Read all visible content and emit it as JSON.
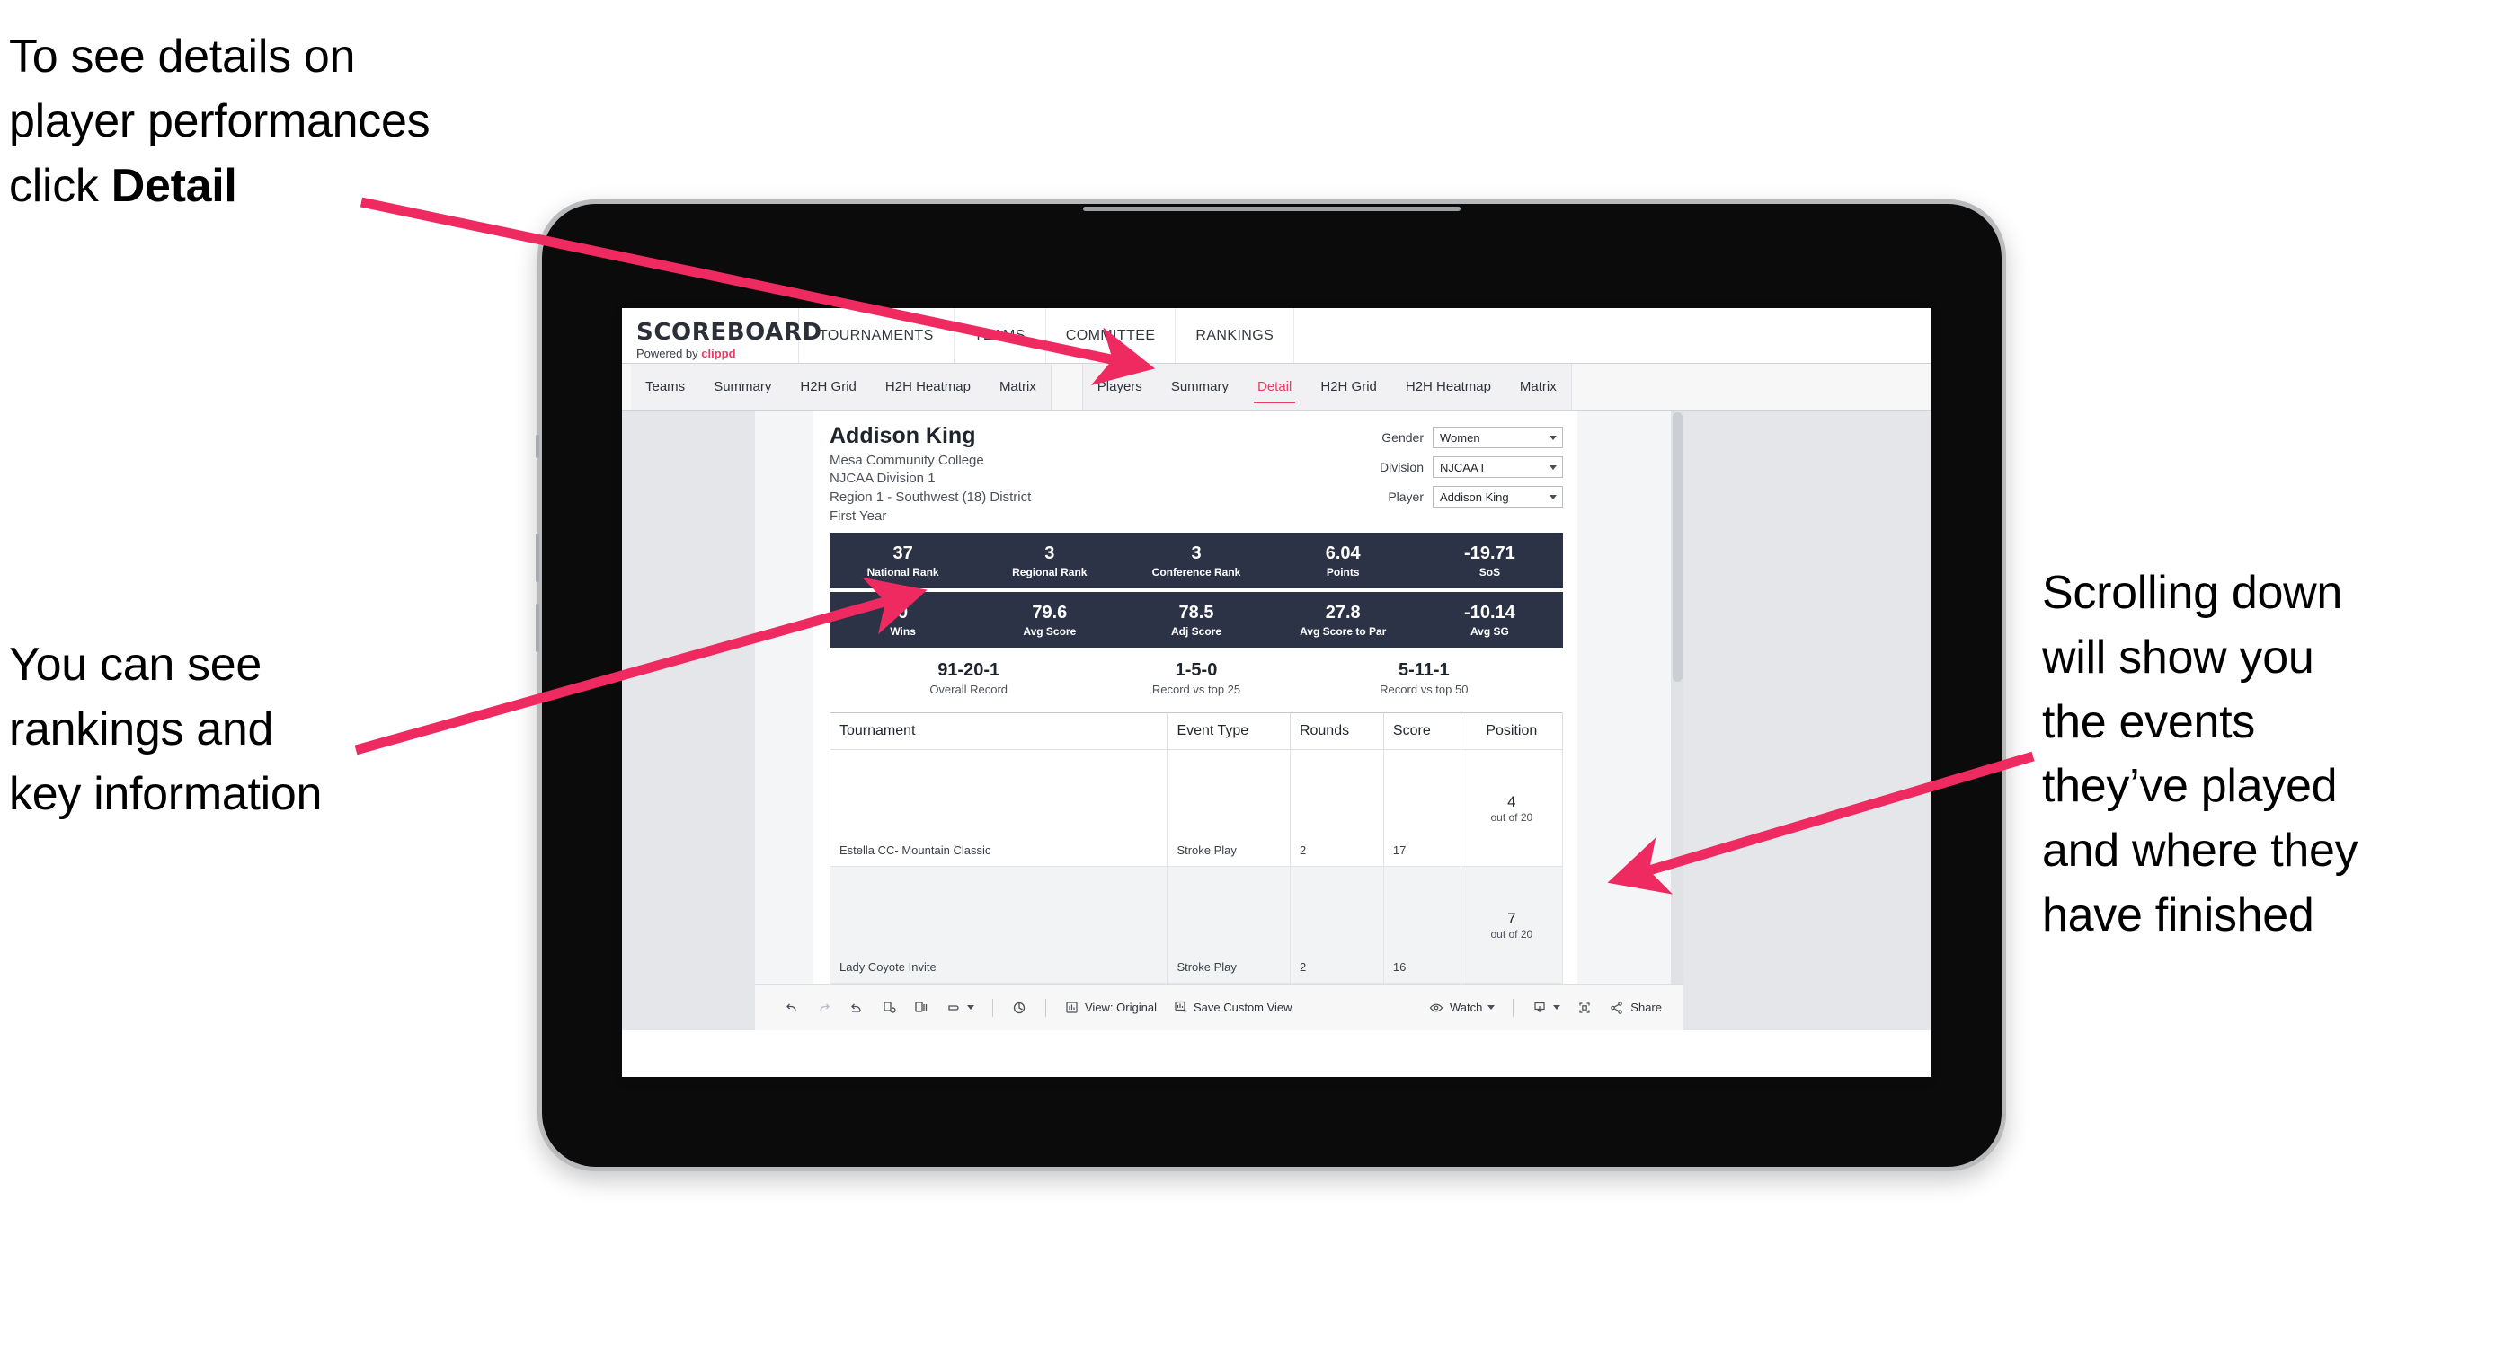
{
  "annotations": {
    "detail_hint": {
      "line1": "To see details on",
      "line2": "player performances",
      "line3_pre": "click ",
      "line3_bold": "Detail"
    },
    "rankings_hint": {
      "line1": "You can see",
      "line2": "rankings and",
      "line3": "key information"
    },
    "scroll_hint": {
      "line1": "Scrolling down",
      "line2": "will show you",
      "line3": "the events",
      "line4": "they’ve played",
      "line5": "and where they",
      "line6": "have finished"
    },
    "arrow_color": "#ee2a61"
  },
  "app": {
    "logo": {
      "title": "SCOREBOARD",
      "powered_prefix": "Powered by ",
      "powered_brand": "clippd"
    },
    "main_nav": [
      {
        "label": "TOURNAMENTS"
      },
      {
        "label": "TEAMS"
      },
      {
        "label": "COMMITTEE"
      },
      {
        "label": "RANKINGS"
      }
    ],
    "tab_groups": [
      {
        "name": "teams-group",
        "tabs": [
          {
            "label": "Teams",
            "active": false
          },
          {
            "label": "Summary",
            "active": false
          },
          {
            "label": "H2H Grid",
            "active": false
          },
          {
            "label": "H2H Heatmap",
            "active": false
          },
          {
            "label": "Matrix",
            "active": false
          }
        ]
      },
      {
        "name": "players-group",
        "tabs": [
          {
            "label": "Players",
            "active": false
          },
          {
            "label": "Summary",
            "active": false
          },
          {
            "label": "Detail",
            "active": true
          },
          {
            "label": "H2H Grid",
            "active": false
          },
          {
            "label": "H2H Heatmap",
            "active": false
          },
          {
            "label": "Matrix",
            "active": false
          }
        ]
      }
    ]
  },
  "player": {
    "name": "Addison King",
    "school": "Mesa Community College",
    "division": "NJCAA Division 1",
    "region": "Region 1 - Southwest (18) District",
    "year": "First Year"
  },
  "filters": [
    {
      "label": "Gender",
      "value": "Women"
    },
    {
      "label": "Division",
      "value": "NJCAA I"
    },
    {
      "label": "Player",
      "value": "Addison King"
    }
  ],
  "stat_band_1": [
    {
      "value": "37",
      "label": "National Rank"
    },
    {
      "value": "3",
      "label": "Regional Rank"
    },
    {
      "value": "3",
      "label": "Conference Rank"
    },
    {
      "value": "6.04",
      "label": "Points"
    },
    {
      "value": "-19.71",
      "label": "SoS"
    }
  ],
  "stat_band_2": [
    {
      "value": "0",
      "label": "Wins"
    },
    {
      "value": "79.6",
      "label": "Avg Score"
    },
    {
      "value": "78.5",
      "label": "Adj Score"
    },
    {
      "value": "27.8",
      "label": "Avg Score to Par"
    },
    {
      "value": "-10.14",
      "label": "Avg SG"
    }
  ],
  "records": [
    {
      "value": "91-20-1",
      "label": "Overall Record"
    },
    {
      "value": "1-5-0",
      "label": "Record vs top 25"
    },
    {
      "value": "5-11-1",
      "label": "Record vs top 50"
    }
  ],
  "table": {
    "headers": [
      "Tournament",
      "Event Type",
      "Rounds",
      "Score",
      "Position"
    ],
    "rows": [
      {
        "tournament": "Estella CC- Mountain Classic",
        "event_type": "Stroke Play",
        "rounds": "2",
        "score": "17",
        "position_num": "4",
        "position_sub": "out of 20"
      },
      {
        "tournament": "Lady Coyote Invite",
        "event_type": "Stroke Play",
        "rounds": "2",
        "score": "16",
        "position_num": "7",
        "position_sub": "out of 20"
      }
    ]
  },
  "toolbar": {
    "view_label": "View: Original",
    "save_label": "Save Custom View",
    "watch_label": "Watch",
    "share_label": "Share"
  },
  "colors": {
    "accent_pink": "#ee3a63",
    "stat_band_navy": "#2d3346",
    "viz_background": "#e4e6e9"
  }
}
